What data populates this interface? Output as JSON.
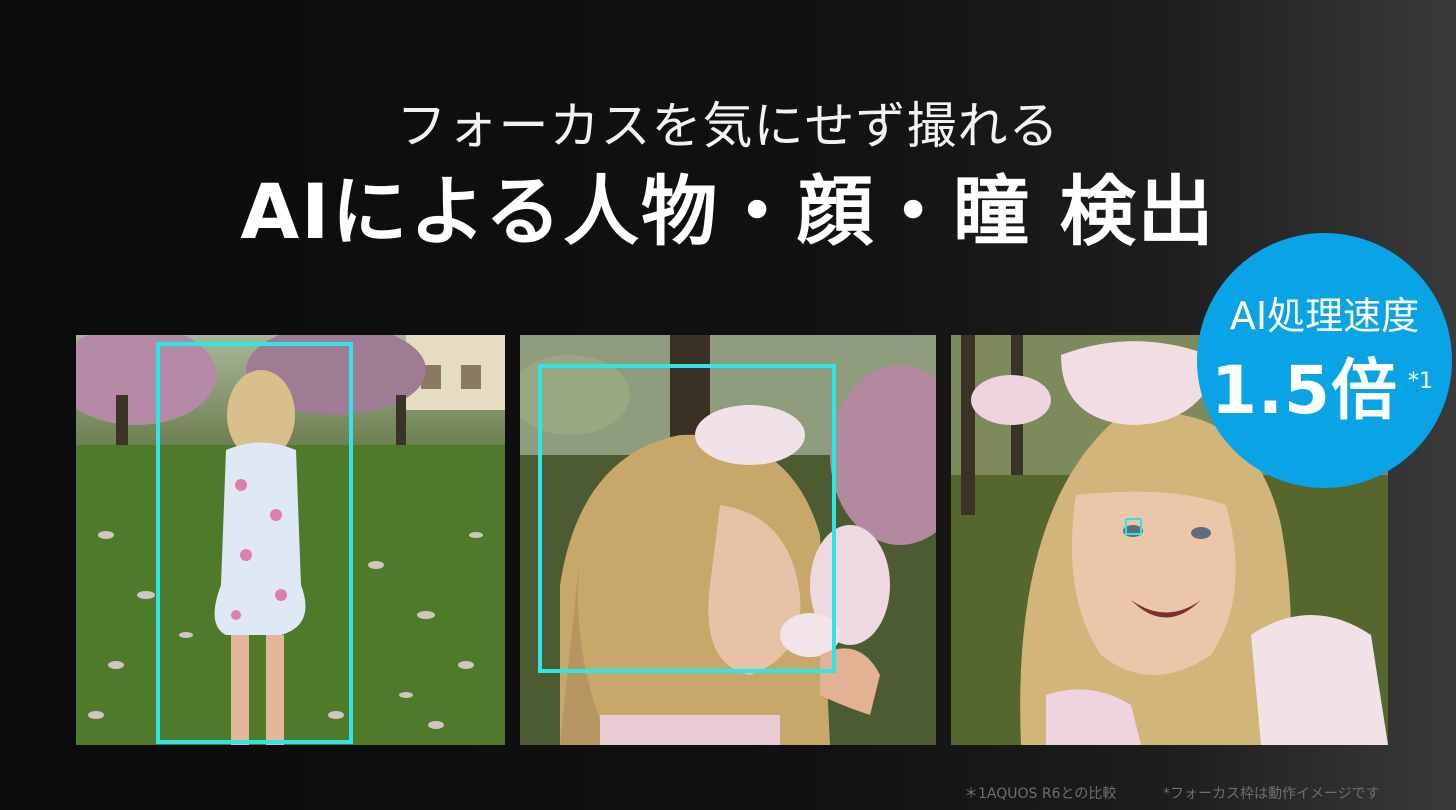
{
  "heading": {
    "subtitle": "フォーカスを気にせず撮れる",
    "title": "AIによる人物・顔・瞳 検出"
  },
  "photos": [
    {
      "label": "",
      "detection": "person"
    },
    {
      "label": "",
      "detection": "face"
    },
    {
      "label": "",
      "detection": "eye"
    }
  ],
  "badge": {
    "line1": "AI処理速度",
    "value": "1.5倍",
    "note": "*1"
  },
  "footnotes": {
    "comparison": "＊1AQUOS R6との比較",
    "frame_note": "*フォーカス枠は動作イメージです"
  },
  "colors": {
    "focus_frame": "#2ee6e6",
    "badge": "#0aa3e6",
    "background": "#111111"
  }
}
